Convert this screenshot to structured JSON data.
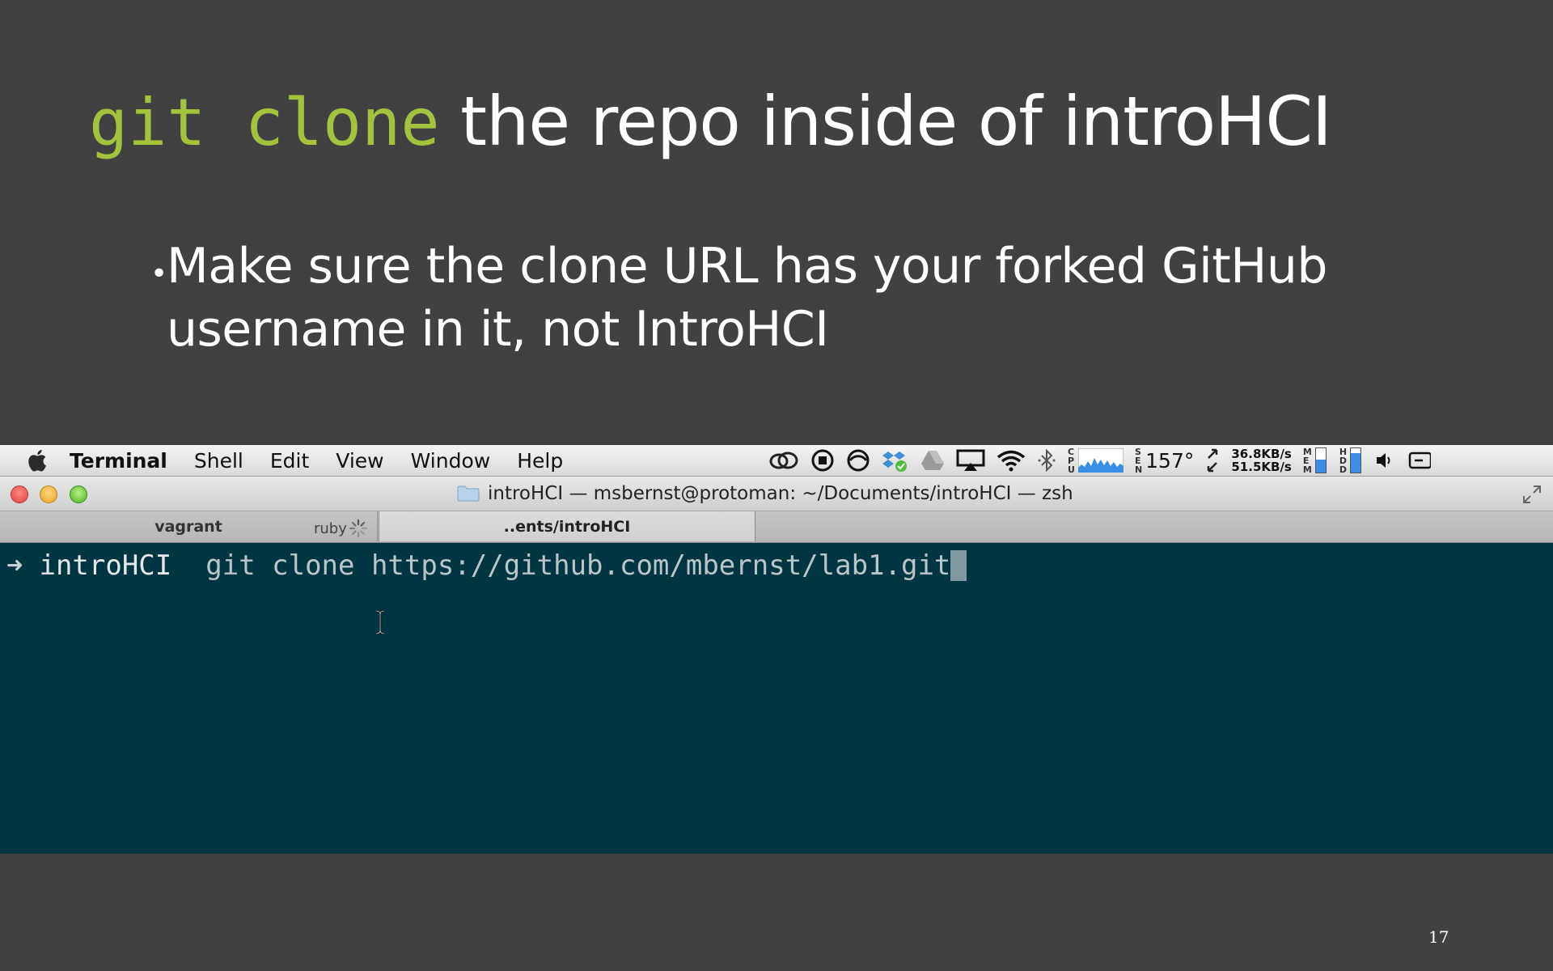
{
  "slide": {
    "title_code": "git clone",
    "title_rest": " the repo inside of introHCI",
    "bullet_marker": "•",
    "bullet_text": "Make sure the clone URL has your forked GitHub username in it, not IntroHCI",
    "page_number": "17"
  },
  "menubar": {
    "app_name": "Terminal",
    "items": [
      "Shell",
      "Edit",
      "View",
      "Window",
      "Help"
    ],
    "status": {
      "sen_label": "SEN",
      "temperature": "157°",
      "net_down": "36.8KB/s",
      "net_up": "51.5KB/s",
      "cpu_label": "CPU",
      "mem_label": "MEM",
      "hdd_label": "HDD",
      "mem_level": 0.55,
      "hdd_level": 0.8
    }
  },
  "window": {
    "title": "introHCI — msbernst@protoman: ~/Documents/introHCI — zsh",
    "tabs": [
      {
        "label": "vagrant",
        "sub": "ruby"
      },
      {
        "label": "..ents/introHCI"
      }
    ]
  },
  "terminal": {
    "prompt_arrow": "➜",
    "cwd": "introHCI",
    "command": "git clone https://github.com/mbernst/lab1.git"
  },
  "colors": {
    "slide_bg": "#414141",
    "code_green": "#a3c33d",
    "terminal_bg": "#003542"
  }
}
